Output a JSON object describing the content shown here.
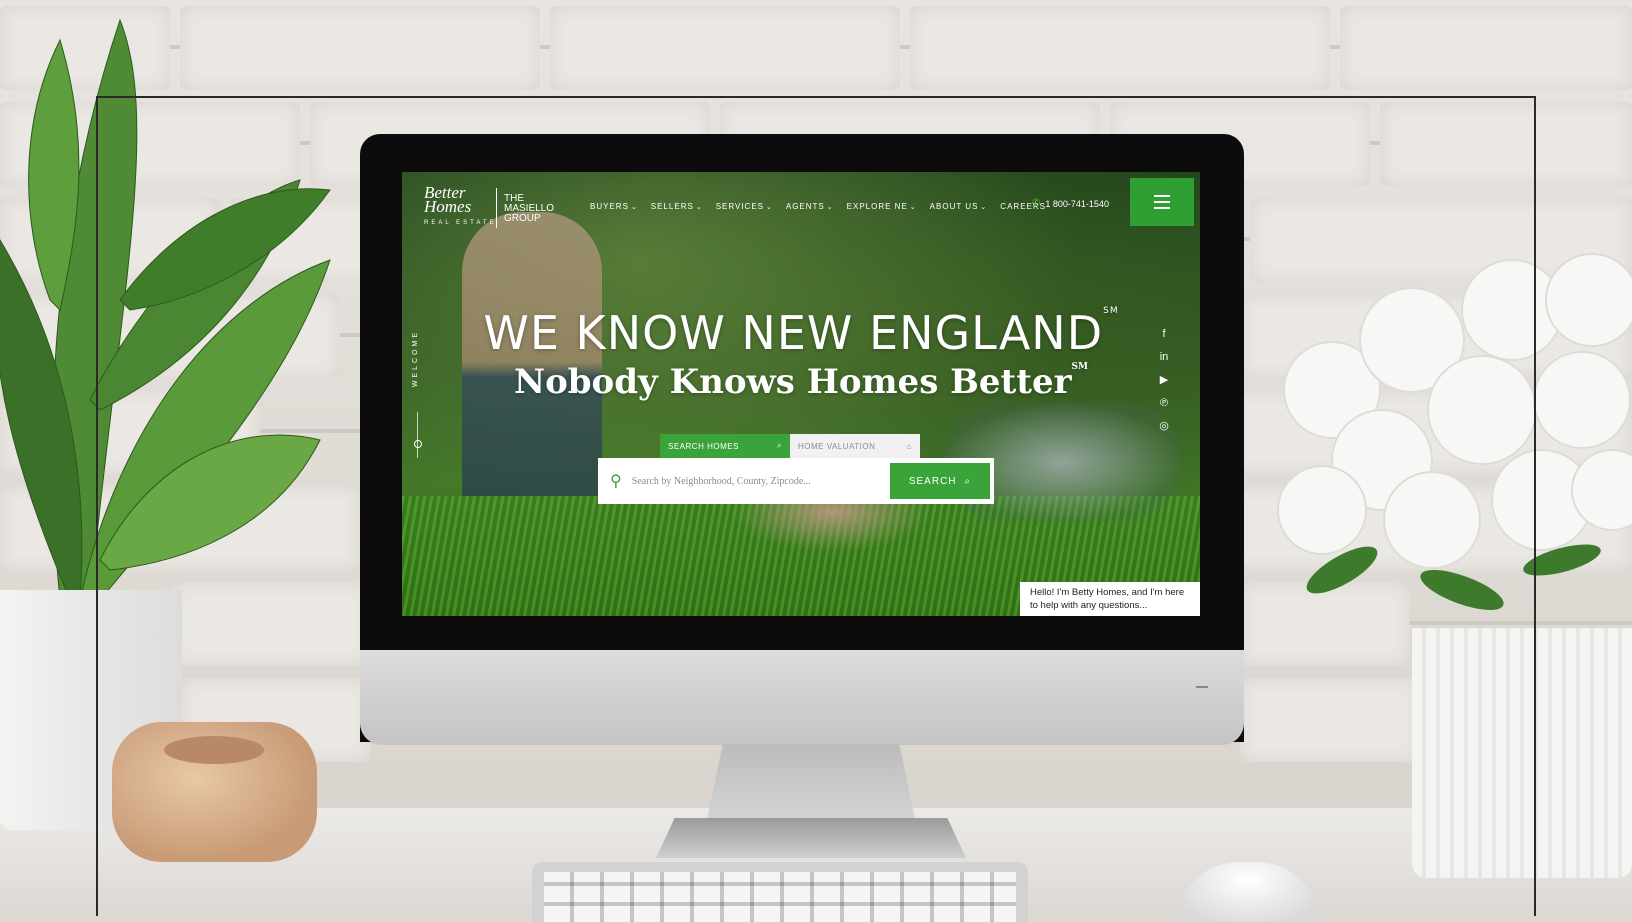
{
  "site": {
    "logo": {
      "brand_top": "Better",
      "brand_bottom": "Homes",
      "brand_tagline": "REAL ESTATE",
      "group": "THE MASIELLO GROUP"
    },
    "nav": [
      {
        "label": "BUYERS",
        "chevron": true
      },
      {
        "label": "SELLERS",
        "chevron": true
      },
      {
        "label": "SERVICES",
        "chevron": true
      },
      {
        "label": "AGENTS",
        "chevron": true
      },
      {
        "label": "EXPLORE NE",
        "chevron": true
      },
      {
        "label": "ABOUT US",
        "chevron": true
      },
      {
        "label": "CAREERS",
        "chevron": false
      }
    ],
    "phone": "1 800-741-1540",
    "menu_icon": "hamburger-icon",
    "welcome": "WELCOME",
    "hero": {
      "title": "WE KNOW NEW ENGLAND",
      "title_mark": "SM",
      "subtitle": "Nobody Knows Homes Better",
      "subtitle_mark": "SM"
    },
    "tabs": [
      {
        "label": "SEARCH HOMES",
        "icon": "search-icon",
        "active": true
      },
      {
        "label": "HOME VALUATION",
        "icon": "home-icon",
        "active": false
      }
    ],
    "search": {
      "placeholder": "Search by Neighborhood, County, Zipcode...",
      "button": "SEARCH"
    },
    "socials": [
      "facebook-icon",
      "linkedin-icon",
      "youtube-icon",
      "pinterest-icon",
      "instagram-icon"
    ],
    "chat": "Hello! I'm Betty Homes, and I'm here to help with any questions..."
  },
  "colors": {
    "accent_green": "#3aa43a",
    "menu_green": "#2f9e33"
  }
}
